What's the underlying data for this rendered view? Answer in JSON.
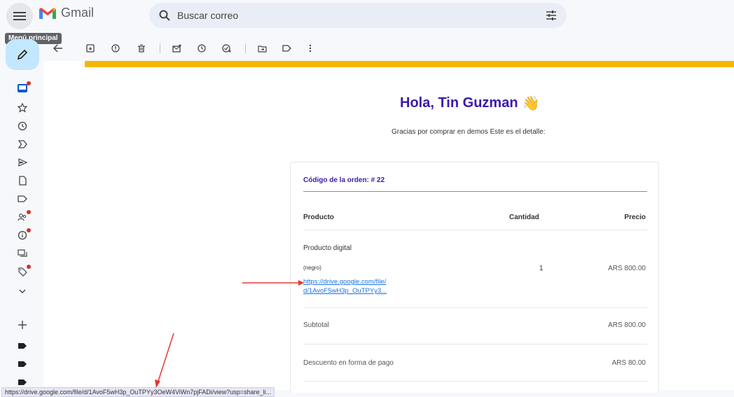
{
  "header": {
    "menu_tooltip": "Menú principal",
    "app_name": "Gmail",
    "search_placeholder": "Buscar correo"
  },
  "email": {
    "greeting": "Hola, Tin Guzman",
    "greeting_emoji": "👋",
    "subtitle": "Gracias por comprar en demos Este es el detalle:",
    "order_label": "Código de la orden: # 22",
    "columns": [
      "Producto",
      "Cantidad",
      "Precio"
    ],
    "item": {
      "name": "Producto digital",
      "variant": "(negro)",
      "link_line1": "https://drive.google.com/file/",
      "link_line2": "d/1AvoF5wH3p_OuTPYy3...",
      "quantity": "1",
      "price": "ARS 800.00"
    },
    "subtotal_label": "Subtotal",
    "subtotal_value": "ARS 800.00",
    "discount_label": "Descuento en forma de pago",
    "discount_value": "ARS 80.00"
  },
  "status_url": "https://drive.google.com/file/d/1AvoF5wH3p_OuTPYy3OeW4ViWn7pjFADi/view?usp=share_li...",
  "colors": {
    "accent_purple": "#3b1aab",
    "banner_yellow": "#f2b705",
    "link_blue": "#1a73e8",
    "compose_bg": "#c2e7ff",
    "badge_red": "#d93025",
    "arrow_red": "#e53935"
  }
}
